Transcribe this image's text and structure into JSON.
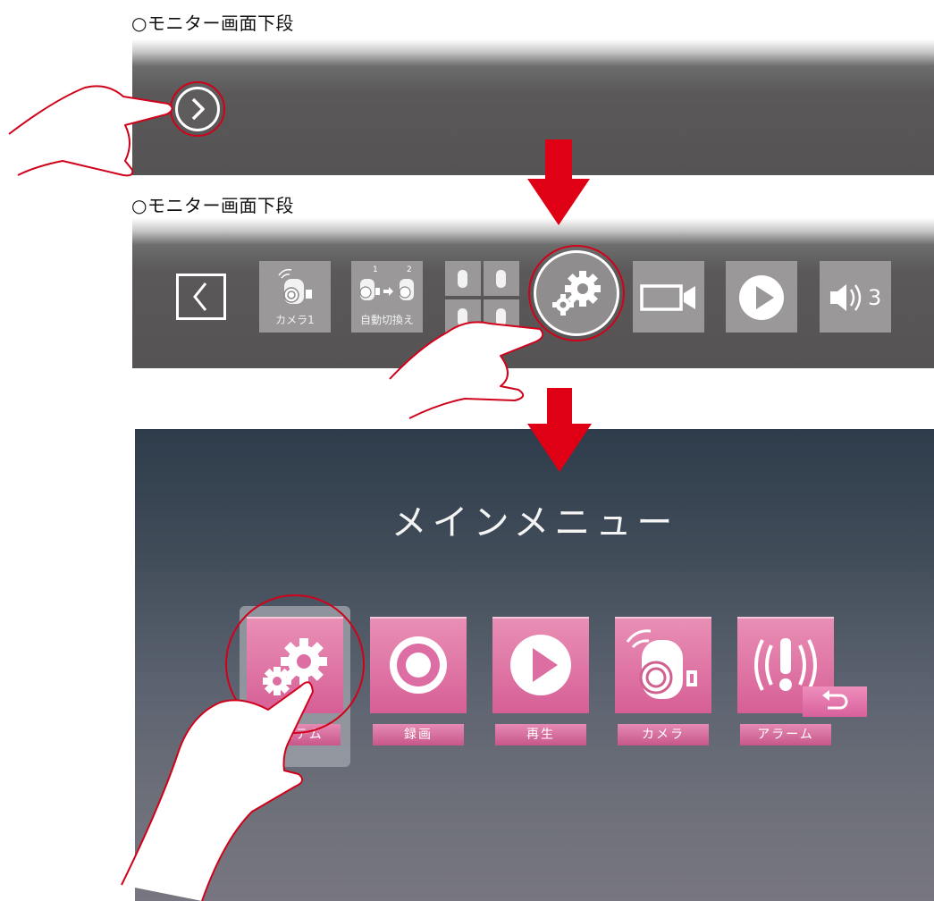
{
  "captions": {
    "first": "○モニター画面下段",
    "second": "○モニター画面下段"
  },
  "toolbar": {
    "camera_label": "カメラ1",
    "auto_switch_label": "自動切換え",
    "auto_switch_cam_a": "1",
    "auto_switch_cam_b": "2",
    "volume_level": "3"
  },
  "main_menu": {
    "title": "メインメニュー",
    "items": [
      {
        "label": "システム",
        "icon": "gears-icon"
      },
      {
        "label": "録画",
        "icon": "record-icon"
      },
      {
        "label": "再生",
        "icon": "play-icon"
      },
      {
        "label": "カメラ",
        "icon": "camera-icon"
      },
      {
        "label": "アラーム",
        "icon": "alarm-icon"
      }
    ]
  },
  "colors": {
    "accent_red": "#d0021b",
    "menu_pink": "#d9669c",
    "toolbar_gray": "#555353"
  }
}
